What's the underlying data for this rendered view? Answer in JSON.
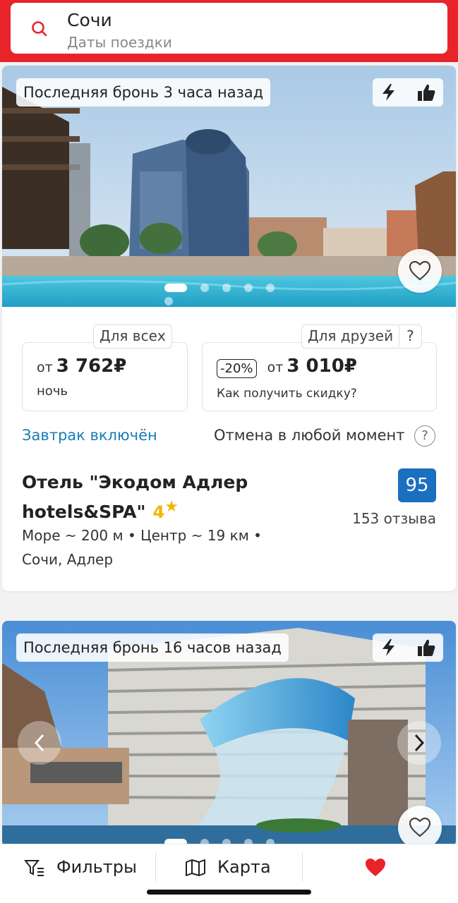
{
  "search": {
    "city": "Сочи",
    "dates_placeholder": "Даты поездки",
    "icon": "search-icon"
  },
  "hotels": [
    {
      "last_booking": "Последняя бронь 3 часа назад",
      "price_all": {
        "tag": "Для всех",
        "from": "от",
        "value": "3 762₽",
        "per": "ночь"
      },
      "price_friends": {
        "tag": "Для друзей",
        "tag_help": "?",
        "discount": "-20%",
        "from": "от",
        "value": "3 010₽",
        "how": "Как получить скидку?"
      },
      "breakfast": "Завтрак включён",
      "cancellation": "Отмена в любой момент",
      "cancellation_help": "?",
      "name": "Отель \"Экодом Адлер hotels&SPA\"",
      "stars": "4",
      "rating": "95",
      "reviews": "153 отзыва",
      "distances": "Море ~ 200 м  •  Центр ~ 19 км  •",
      "location": "Сочи, Адлер"
    },
    {
      "last_booking": "Последняя бронь 16 часов назад"
    }
  ],
  "bottom_bar": {
    "filters": "Фильтры",
    "map": "Карта",
    "favorites_icon": "heart-icon"
  },
  "colors": {
    "brand_red": "#e8232a",
    "link_blue": "#1a7cb8",
    "rating_blue": "#1a6fc0",
    "star_yellow": "#f5b400"
  }
}
